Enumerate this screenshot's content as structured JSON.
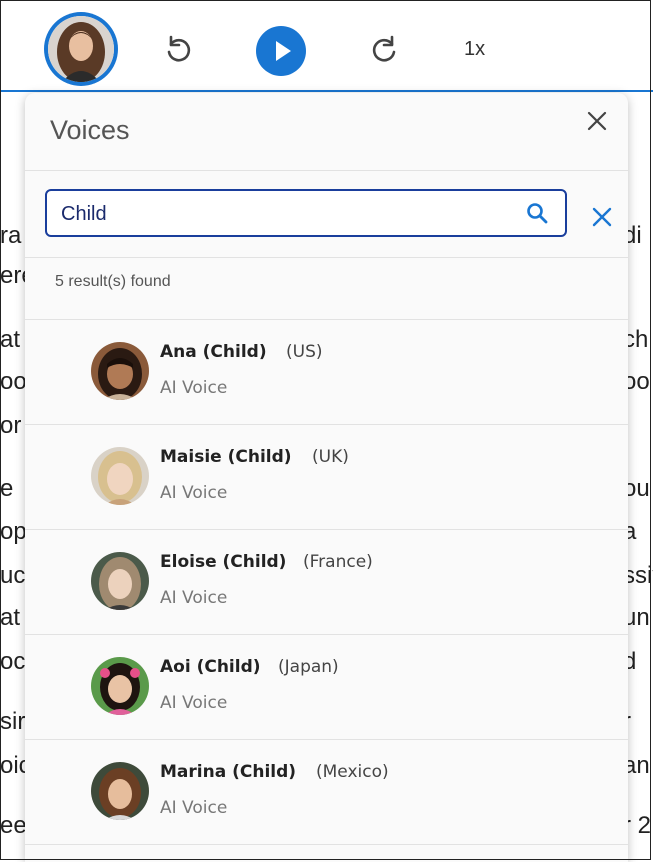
{
  "toolbar": {
    "speed_label": "1x",
    "accent_color": "#1976d2"
  },
  "background_text": {
    "left": [
      "ra",
      "ere",
      "at",
      "oo",
      "or",
      "e",
      "op",
      "uc",
      "at",
      "oc",
      "sir",
      "oic",
      "ee"
    ],
    "right": [
      "di",
      "ch",
      "oo",
      "ou",
      "a",
      "ssiv",
      "un",
      "d",
      "r",
      "an",
      "r 2"
    ]
  },
  "panel": {
    "title": "Voices",
    "search": {
      "value": "Child",
      "placeholder": ""
    },
    "results_label": "5 result(s) found",
    "voices": [
      {
        "name": "Ana (Child)",
        "region": "(US)",
        "type": "AI Voice"
      },
      {
        "name": "Maisie (Child)",
        "region": "(UK)",
        "type": "AI Voice"
      },
      {
        "name": "Eloise (Child)",
        "region": "(France)",
        "type": "AI Voice"
      },
      {
        "name": "Aoi (Child)",
        "region": "(Japan)",
        "type": "AI Voice"
      },
      {
        "name": "Marina (Child)",
        "region": "(Mexico)",
        "type": "AI Voice"
      }
    ]
  },
  "icons": {
    "undo": "rotate-ccw-icon",
    "play": "play-icon",
    "redo": "rotate-cw-icon",
    "search": "search-icon",
    "close": "close-icon",
    "clear": "clear-icon"
  }
}
